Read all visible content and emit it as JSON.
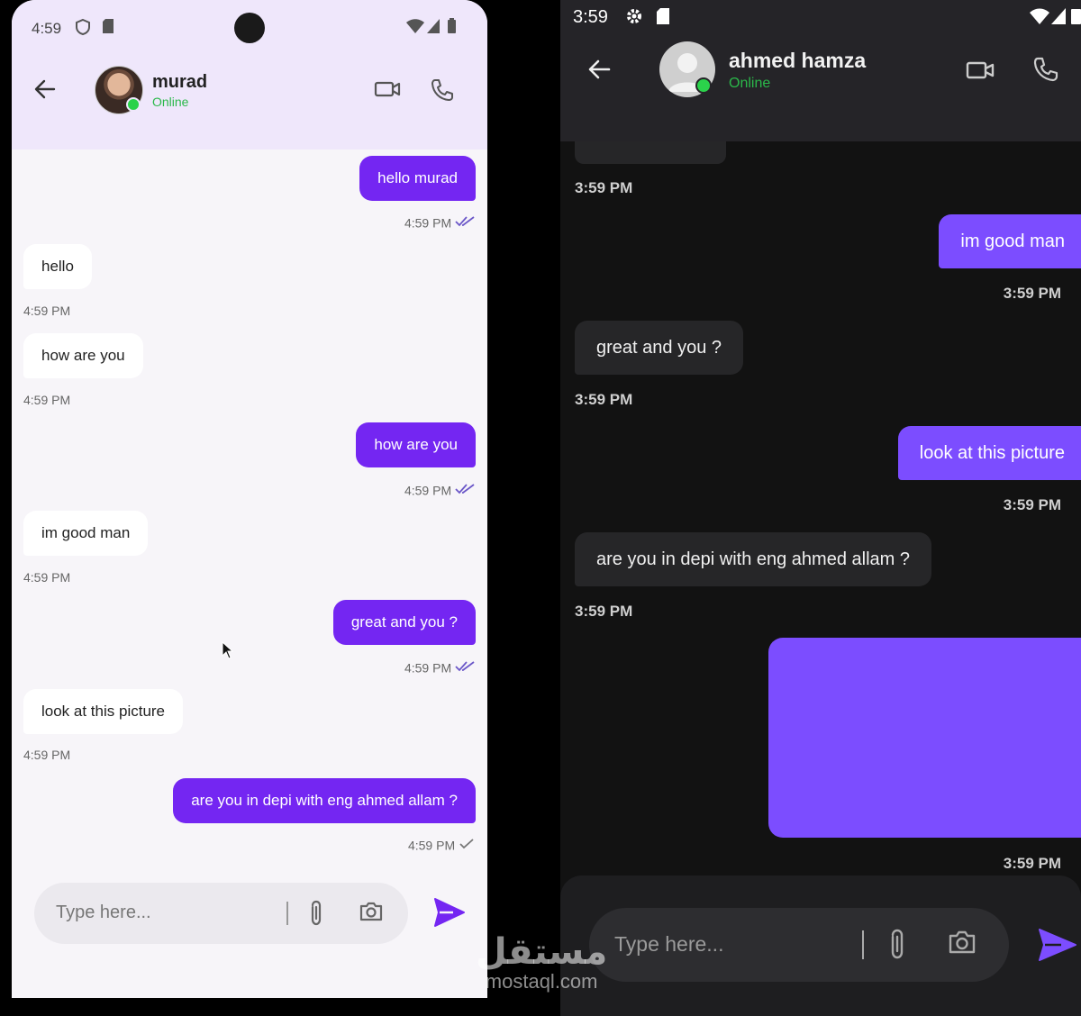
{
  "left_phone": {
    "status": {
      "time": "4:59"
    },
    "header": {
      "contact_name": "murad",
      "presence": "Online"
    },
    "messages": [
      {
        "direction": "out",
        "text": "hello murad",
        "time": "4:59 PM",
        "receipt": "read"
      },
      {
        "direction": "in",
        "text": "hello",
        "time": "4:59 PM"
      },
      {
        "direction": "in",
        "text": "how are you",
        "time": "4:59 PM"
      },
      {
        "direction": "out",
        "text": "how are you",
        "time": "4:59 PM",
        "receipt": "read"
      },
      {
        "direction": "in",
        "text": "im good man",
        "time": "4:59 PM"
      },
      {
        "direction": "out",
        "text": "great and you ?",
        "time": "4:59 PM",
        "receipt": "read"
      },
      {
        "direction": "in",
        "text": "look at this picture",
        "time": "4:59 PM"
      },
      {
        "direction": "out",
        "text": "are you in depi with eng ahmed allam ?",
        "time": "4:59 PM",
        "receipt": "sent"
      }
    ],
    "composer": {
      "placeholder": "Type here..."
    }
  },
  "right_phone": {
    "status": {
      "time": "3:59"
    },
    "header": {
      "contact_name": "ahmed hamza",
      "presence": "Online"
    },
    "messages": [
      {
        "direction": "in",
        "text": "",
        "time": "3:59 PM"
      },
      {
        "direction": "out",
        "text": "im good man",
        "time": "3:59 PM",
        "receipt": "read"
      },
      {
        "direction": "in",
        "text": "great and you ?",
        "time": "3:59 PM"
      },
      {
        "direction": "out",
        "text": "look at this picture",
        "time": "3:59 PM",
        "receipt": "read"
      },
      {
        "direction": "in",
        "text": "are you in depi with eng ahmed allam ?",
        "time": "3:59 PM"
      },
      {
        "direction": "out",
        "type": "image",
        "time": "3:59 PM",
        "receipt": "read"
      }
    ],
    "composer": {
      "placeholder": "Type here..."
    }
  },
  "watermark": {
    "brand": "مستقل",
    "domain": "mostaql.com"
  },
  "colors": {
    "accent": "#7426f2",
    "accent_dark_theme": "#7c4dff",
    "online": "#2bd24b",
    "header_light": "#efe7fb",
    "header_dark": "#252428"
  }
}
